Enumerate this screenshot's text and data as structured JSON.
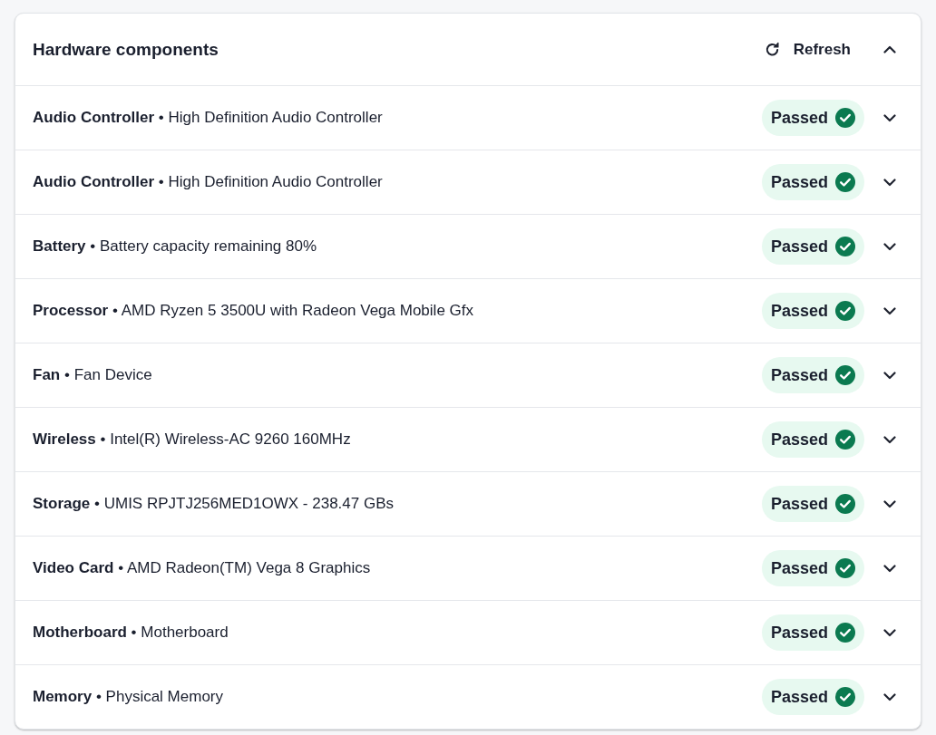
{
  "panel": {
    "title": "Hardware components",
    "refresh_label": "Refresh",
    "expanded": true
  },
  "components": [
    {
      "text": "**Audio Controller** • High Definition Audio Controller",
      "status": "Passed",
      "passed": true,
      "expanded": false
    },
    {
      "text": "**Audio Controller** • High Definition Audio Controller",
      "status": "Passed",
      "passed": true,
      "expanded": false
    },
    {
      "text": "**Battery** • Battery capacity remaining 80%",
      "status": "Passed",
      "passed": true,
      "expanded": false
    },
    {
      "text": "**Processor** • AMD Ryzen 5 3500U with Radeon Vega Mobile Gfx",
      "status": "Passed",
      "passed": true,
      "expanded": false
    },
    {
      "text": "**Fan** • Fan Device",
      "status": "Passed",
      "passed": true,
      "expanded": false
    },
    {
      "text": "**Wireless** • Intel(R) Wireless-AC 9260 160MHz",
      "status": "Passed",
      "passed": true,
      "expanded": false
    },
    {
      "text": "**Storage** • UMIS RPJTJ256MED1OWX - 238.47 GBs",
      "status": "Passed",
      "passed": true,
      "expanded": false
    },
    {
      "text": "**Video Card** • AMD Radeon(TM) Vega 8 Graphics",
      "status": "Passed",
      "passed": true,
      "expanded": false
    },
    {
      "text": "**Motherboard** • Motherboard",
      "status": "Passed",
      "passed": true,
      "expanded": false
    },
    {
      "text": "**Memory** • Physical Memory",
      "status": "Passed",
      "passed": true,
      "expanded": false
    }
  ]
}
